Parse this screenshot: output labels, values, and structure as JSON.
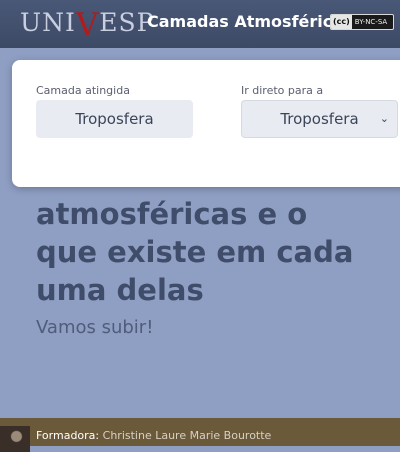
{
  "header": {
    "logo_left": "UNI",
    "logo_v": "V",
    "logo_right": "ESP",
    "title": "Camadas Atmosféricas",
    "license_cc": "(cc)",
    "license_text": "BY-NC-SA"
  },
  "hero": {
    "title_lines": [
      "atmosféricas e o",
      "que existe em cada",
      "uma delas"
    ],
    "subtitle": "Vamos subir!"
  },
  "panel": {
    "camada_label": "Camada atingida",
    "camada_value": "Troposfera",
    "direto_label": "Ir direto para a",
    "direto_value": "Troposfera",
    "direto_caret": "⌄"
  },
  "footer": {
    "role": "Formadora:",
    "name": "Christine Laure Marie Bourotte"
  },
  "colors": {
    "header_bg": "#495877",
    "page_bg": "#8f9fc4",
    "accent_red": "#b31b1b",
    "footer_bg": "#6b5a3a"
  }
}
